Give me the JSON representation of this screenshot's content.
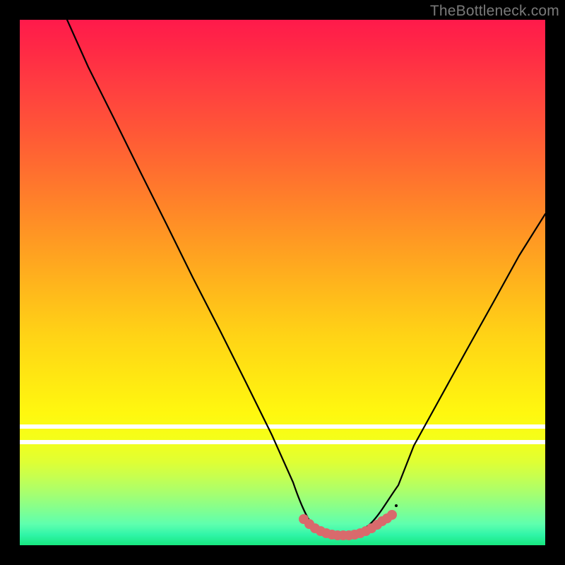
{
  "watermark": {
    "text": "TheBottleneck.com"
  },
  "colors": {
    "page_bg": "#000000",
    "curve": "#000000",
    "marker": "#d96a6c",
    "white_band": "#ffffff",
    "watermark": "#7a7a7a",
    "gradient_top": "#ff1a4b",
    "gradient_bottom": "#17e77f"
  },
  "chart_data": {
    "type": "line",
    "title": "",
    "xlabel": "",
    "ylabel": "",
    "xlim": [
      0,
      100
    ],
    "ylim": [
      0,
      100
    ],
    "grid": false,
    "legend": false,
    "series": [
      {
        "name": "curve",
        "x": [
          9,
          13,
          18,
          23,
          28,
          33,
          38,
          43,
          48,
          52,
          55,
          58,
          60,
          62,
          64,
          66,
          70,
          75,
          80,
          85,
          90,
          95,
          100
        ],
        "y": [
          100,
          91,
          81,
          71,
          61,
          51,
          41,
          31,
          21,
          12,
          6,
          3,
          2,
          2,
          2,
          3,
          5,
          11,
          19,
          28,
          37,
          46,
          55
        ]
      }
    ],
    "markers": {
      "name": "highlight-band",
      "x": [
        54,
        55,
        56,
        57,
        58,
        59,
        60,
        61,
        62,
        63,
        64,
        65,
        66,
        67,
        68,
        69,
        70
      ],
      "y": [
        5,
        4,
        3.5,
        3,
        2.5,
        2.2,
        2,
        2,
        2,
        2,
        2.2,
        2.5,
        3,
        3.5,
        4,
        4.5,
        5.2
      ]
    },
    "bands": {
      "white_low": {
        "y": 20
      },
      "white_high": {
        "y": 23
      }
    }
  }
}
